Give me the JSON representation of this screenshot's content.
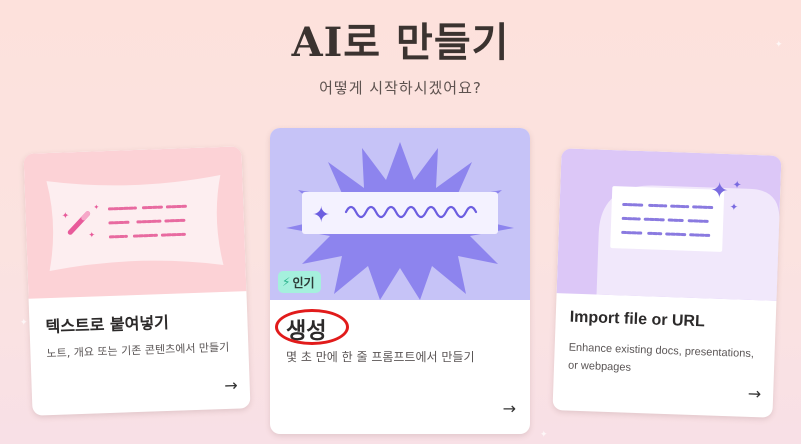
{
  "header": {
    "title": "AI로 만들기",
    "subtitle": "어떻게 시작하시겠어요?"
  },
  "cards": [
    {
      "id": "paste",
      "title": "텍스트로 붙여넣기",
      "description": "노트, 개요 또는 기존 콘텐츠에서 만들기",
      "arrow": "→",
      "illustration_color": "#fcd2d6"
    },
    {
      "id": "generate",
      "badge": "인기",
      "title": "생성",
      "description": "몇 초 만에 한 줄 프롬프트에서 만들기",
      "arrow": "→",
      "illustration_color": "#c6c3f7"
    },
    {
      "id": "import",
      "title": "Import file or URL",
      "description": "Enhance existing docs, presentations, or webpages",
      "arrow": "→",
      "illustration_color": "#dcc7f7"
    }
  ],
  "colors": {
    "badge_bg": "#a5f0dd",
    "highlight_ring": "#e11b1b",
    "accent_pink": "#e85a9a",
    "accent_purple": "#7a6be0"
  }
}
